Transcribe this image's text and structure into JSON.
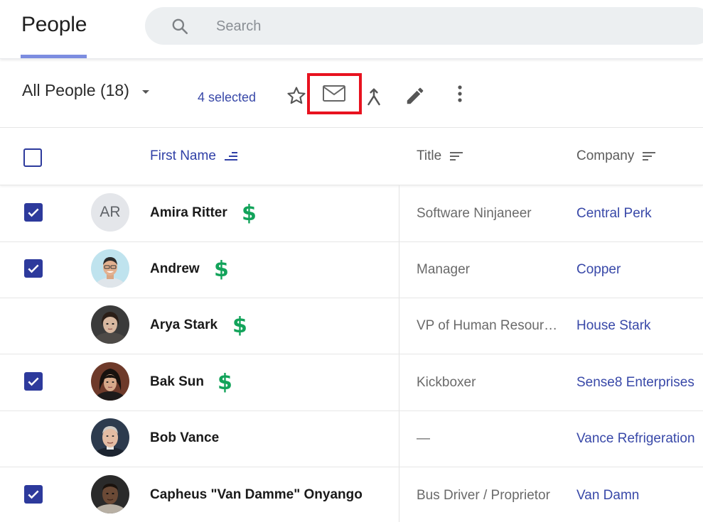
{
  "header": {
    "title": "People",
    "search_placeholder": "Search"
  },
  "toolbar": {
    "view_label": "All People (18)",
    "selected_text": "4 selected",
    "icons": [
      "star-icon",
      "email-icon",
      "merge-icon",
      "edit-icon",
      "more-vert-icon"
    ],
    "highlight_color": "#e8121f"
  },
  "table": {
    "columns": {
      "first_name": "First Name",
      "title": "Title",
      "company": "Company"
    },
    "rows": [
      {
        "checked": true,
        "avatar": "AR",
        "name": "Amira Ritter",
        "customer": true,
        "title": "Software Ninjaneer",
        "company": "Central Perk"
      },
      {
        "checked": true,
        "avatar": "photo",
        "name": "Andrew",
        "customer": true,
        "title": "Manager",
        "company": "Copper"
      },
      {
        "checked": false,
        "avatar": "photo",
        "name": "Arya Stark",
        "customer": true,
        "title": "VP of Human Resour…",
        "company": "House Stark"
      },
      {
        "checked": true,
        "avatar": "photo",
        "name": "Bak Sun",
        "customer": true,
        "title": "Kickboxer",
        "company": "Sense8 Enterprises"
      },
      {
        "checked": false,
        "avatar": "photo",
        "name": "Bob Vance",
        "customer": false,
        "title": "—",
        "company": "Vance Refrigeration"
      },
      {
        "checked": true,
        "avatar": "photo",
        "name": "Capheus \"Van Damme\" Onyango",
        "customer": false,
        "title": "Bus Driver / Proprietor",
        "company": "Van Damn"
      }
    ],
    "customer_symbol": "$"
  },
  "colors": {
    "accent": "#2d3a9c",
    "link": "#3848a8",
    "money": "#12a35a",
    "tab_underline": "#7c8de0"
  }
}
